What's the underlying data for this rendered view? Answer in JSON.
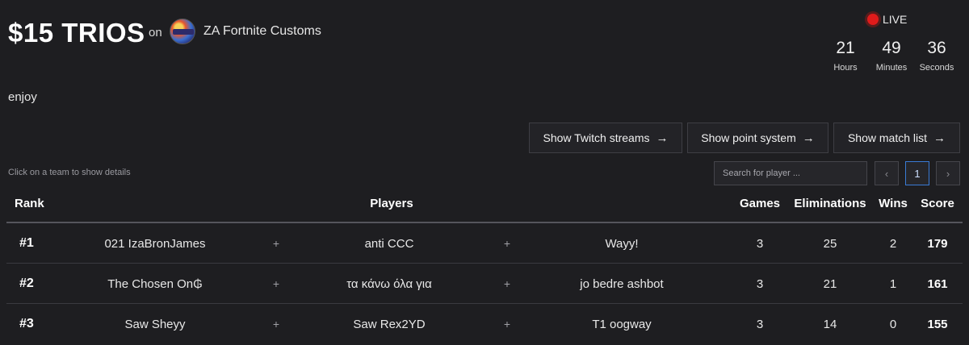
{
  "header": {
    "title": "$15 TRIOS",
    "on_word": "on",
    "org_name": "ZA Fortnite Customs",
    "live_label": "LIVE",
    "countdown": [
      {
        "value": "21",
        "label": "Hours"
      },
      {
        "value": "49",
        "label": "Minutes"
      },
      {
        "value": "36",
        "label": "Seconds"
      }
    ]
  },
  "description": "enjoy",
  "buttons": {
    "twitch": "Show Twitch streams",
    "points": "Show point system",
    "matches": "Show match list",
    "arrow": "→"
  },
  "controls": {
    "hint": "Click on a team to show details",
    "search_placeholder": "Search for player ...",
    "prev": "‹",
    "page": "1",
    "next": "›"
  },
  "table": {
    "columns": {
      "rank": "Rank",
      "players": "Players",
      "games": "Games",
      "eliminations": "Eliminations",
      "wins": "Wins",
      "score": "Score"
    },
    "separator": "+",
    "rows": [
      {
        "rank": "#1",
        "players": [
          "021 IzaBronJames",
          "anti CCC",
          "Wayy!"
        ],
        "games": "3",
        "eliminations": "25",
        "wins": "2",
        "score": "179"
      },
      {
        "rank": "#2",
        "players": [
          "The Chosen On₲",
          "τα κάνω όλα για",
          "jo bedre ashbot"
        ],
        "games": "3",
        "eliminations": "21",
        "wins": "1",
        "score": "161"
      },
      {
        "rank": "#3",
        "players": [
          "Saw Sheyy",
          "Saw Rex2YD",
          "T1 oogway"
        ],
        "games": "3",
        "eliminations": "14",
        "wins": "0",
        "score": "155"
      }
    ]
  },
  "colors": {
    "background": "#1e1e21",
    "live_dot": "#e01b1b",
    "active_page_border": "#3a7bd5"
  }
}
